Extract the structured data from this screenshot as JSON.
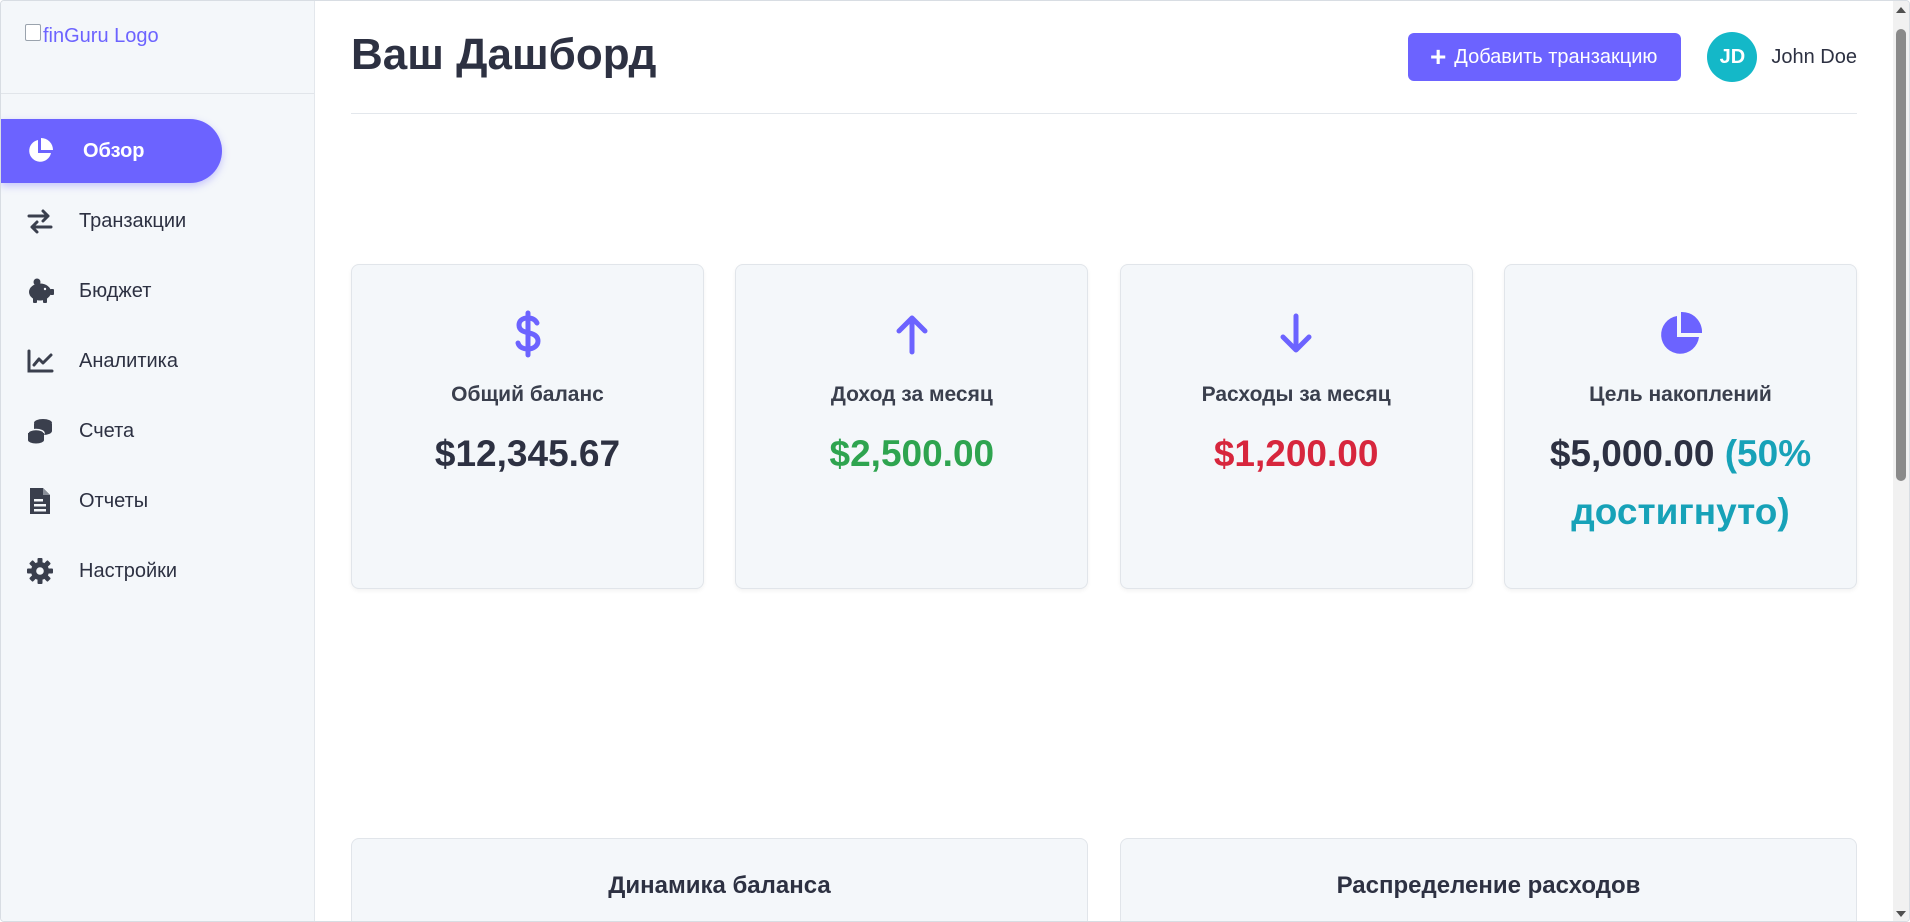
{
  "sidebar": {
    "logo_alt": "finGuru Logo",
    "items": [
      {
        "label": "Обзор",
        "icon": "pie-chart-icon",
        "active": true
      },
      {
        "label": "Транзакции",
        "icon": "exchange-icon"
      },
      {
        "label": "Бюджет",
        "icon": "piggy-bank-icon"
      },
      {
        "label": "Аналитика",
        "icon": "line-chart-icon"
      },
      {
        "label": "Счета",
        "icon": "coins-icon"
      },
      {
        "label": "Отчеты",
        "icon": "file-report-icon"
      },
      {
        "label": "Настройки",
        "icon": "gear-icon"
      }
    ]
  },
  "header": {
    "title": "Ваш Дашборд",
    "add_button": "Добавить транзакцию",
    "user_initials": "JD",
    "user_name": "John Doe"
  },
  "cards": [
    {
      "icon": "dollar-icon",
      "label": "Общий баланс",
      "value": "$12,345.67"
    },
    {
      "icon": "arrow-up-icon",
      "label": "Доход за месяц",
      "value": "$2,500.00"
    },
    {
      "icon": "arrow-down-icon",
      "label": "Расходы за месяц",
      "value": "$1,200.00"
    },
    {
      "icon": "pie-chart-icon",
      "label": "Цель накоплений",
      "value": "$5,000.00",
      "value_extra": "(50% достигнуто)"
    }
  ],
  "panels": {
    "balance_dynamics": "Динамика баланса",
    "expense_distribution": "Распределение расходов"
  },
  "colors": {
    "accent": "#6c63ff",
    "avatar": "#14b8c8",
    "income": "#2ea44f",
    "expense": "#d7263d",
    "goal": "#17a2b8"
  }
}
